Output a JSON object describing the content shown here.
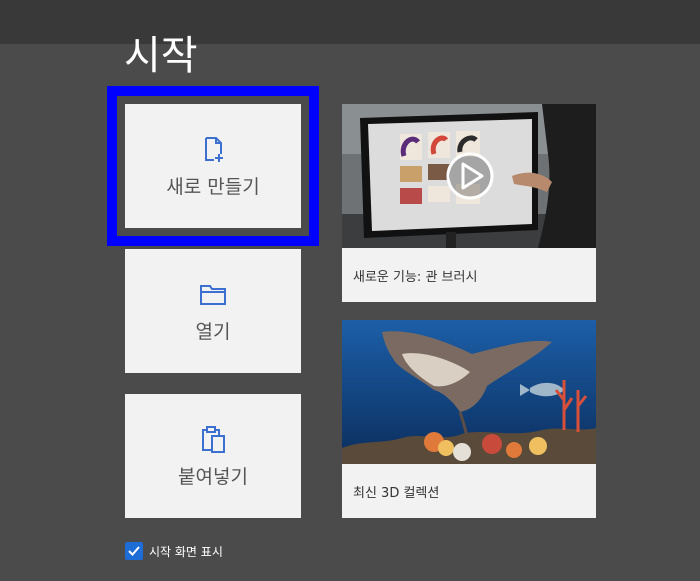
{
  "window": {
    "title": "시작"
  },
  "tiles": {
    "new": {
      "label": "새로 만들기",
      "icon": "new-file-icon"
    },
    "open": {
      "label": "열기",
      "icon": "folder-icon"
    },
    "paste": {
      "label": "붙여넣기",
      "icon": "clipboard-icon"
    }
  },
  "cards": {
    "brush": {
      "caption": "새로운 기능: 관 브러시",
      "thumb": "video-thumbnail-play-icon"
    },
    "collection": {
      "caption": "최신 3D 컬렉션",
      "thumb": "underwater-3d-scene"
    }
  },
  "startup": {
    "label": "시작 화면 표시",
    "checked": true
  },
  "colors": {
    "accent": "#3b7bd4",
    "selection": "#0000ff",
    "background": "#4b4b4b"
  }
}
